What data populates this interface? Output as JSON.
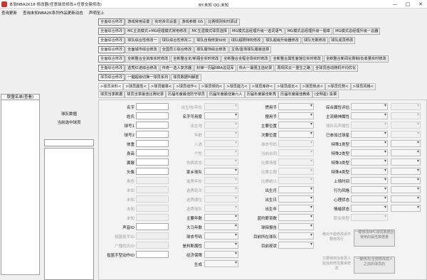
{
  "window": {
    "title": "本软NBA2K18 修改器(任意球员修改+任意交易修改)",
    "contact": "BY:末知 QQ:末知",
    "minimize": "—",
    "maximize": "□",
    "close": "✕"
  },
  "menu": [
    "查询更新",
    "查询末知NBA2K系列作品更新动态",
    "声明至上"
  ],
  "left_panel": {
    "title": "联盟名单(查看)"
  },
  "mid_panel": {
    "label1": "球队数据",
    "label2": "当前选中球员"
  },
  "button_rows": [
    [
      "全面综合修改",
      "游戏常用设置",
      "实时资讯设置",
      "游戏参数 GS",
      "比赛规则实时调试"
    ],
    [
      "全面综合修改",
      "MC主流模式+MG经理模式常用修改",
      "MC生涯模式球员选择",
      "MG模式总经理升级一选词语气",
      "MG模式总经理升级一题章",
      "MG模式总经理升级一总器"
    ],
    [
      "全面综合修改",
      "球队综合性修改一",
      "球队综合性修改二",
      "球队自我修复纠纷",
      "球队超限特权修改",
      "球队超级升级器修改",
      "球队无数修改",
      "球队成员修改"
    ],
    [
      "全面综合修改",
      "全面城市综合修改",
      "全国员工综合修改",
      "球队服饰综合修改",
      "主场/雷场球队服装选择"
    ],
    [
      "全面综合修改",
      "全新整合全资库实时修改",
      "全新整合定/新强全实时修改",
      "全新整合全程全场实时修改",
      "全新整合属性客馆位实时修改",
      "全新整合新闻化赛制/负收量实时修改"
    ],
    [
      "全面综合修改",
      "选秀红诺综合修改",
      "传奇一选人复苏器",
      "封禅一历届NBA总冠军",
      "伟大一最强主选纪录",
      "再现风云一重生之路",
      "全球员自动随机平均优化"
    ],
    [
      "球员综合修改",
      "一键超级切换一球员系列",
      "球员数据叫解密"
    ]
  ],
  "tabs": [
    ">球员资料<",
    ">球员属性<",
    ">球员徽章<",
    ">球员动作<",
    ">球员倾向<",
    ">球员能力<",
    ">球员库存<",
    ">球员成长<",
    ">球员热点<",
    ">球员优势<",
    ">球员风格<",
    "球员当季数据",
    "球员当季最佳比赛纪录",
    "历届年度最佳防守球员",
    "历届年度最佳第六人",
    "历届年度最佳新秀",
    "历届年度最佳教练",
    "(全明星) 投票"
  ],
  "form": {
    "col1": [
      "名字",
      "姓氏",
      "球号1",
      "球号2",
      "体重",
      "身高",
      "翼展",
      "头像",
      "角色",
      "未知",
      "未知",
      "未知",
      "未知",
      "声音ID",
      "投篮投手ID",
      "广播姓氏ID",
      "投篮手型动作ID"
    ],
    "col1_gray": [
      false,
      false,
      false,
      false,
      false,
      false,
      false,
      false,
      true,
      true,
      true,
      true,
      true,
      false,
      true,
      true,
      false
    ],
    "col2": [
      "出生地/年份",
      "名字可用度",
      "出生地",
      "年龄",
      "入选",
      "个性",
      "伤病状态",
      "家乡球队",
      "选秀年份",
      "选秀轮次",
      "选秀顺位",
      "选秀球队",
      "主要年数",
      "大马年数",
      "球衣号码",
      "是判断属性",
      "经济保障",
      "生成"
    ],
    "col2_gray": [
      true,
      false,
      true,
      true,
      true,
      true,
      true,
      false,
      true,
      true,
      true,
      true,
      false,
      false,
      false,
      false,
      false,
      false
    ],
    "col3": [
      "惯用手",
      "擅用手",
      "主要位置",
      "次要位置",
      "球衣号码",
      "当前合同",
      "比赛场景",
      "比赛主题",
      "比赛统计",
      "出生月",
      "出生日",
      "出生年",
      "蓝约薪资数",
      "球探报告",
      "目前所在球队",
      "目前现状"
    ],
    "col3_gray": [
      false,
      false,
      false,
      false,
      true,
      true,
      true,
      true,
      true,
      false,
      false,
      false,
      false,
      false,
      false,
      false
    ],
    "col4": [
      "综合属性评估",
      "主流精神属性",
      "球队名声属性",
      "已参加过球星",
      "特殊1类型",
      "特殊2类型",
      "特殊3类型",
      "特殊4类型",
      "上场时间",
      "行为风格",
      "心理状态",
      "情绪状态",
      "职业类型"
    ],
    "col4_gray": [
      false,
      false,
      true,
      false,
      false,
      false,
      false,
      false,
      false,
      false,
      false,
      false,
      true
    ],
    "notes": [
      "绝对不能修改请不要修改行",
      "只要使用没有再人能找到修改量来修改"
    ],
    "big_buttons": [
      "一键修改NPC球员数据且使用的属性数据量",
      "一键修改/全部修改成人之前的球员的"
    ]
  },
  "colors": {
    "background": "#f0f0f0",
    "app_icon": "#c0392b"
  },
  "icons": [
    "app-icon",
    "minimize-icon",
    "maximize-icon",
    "close-icon",
    "dropdown-arrow-icon"
  ]
}
